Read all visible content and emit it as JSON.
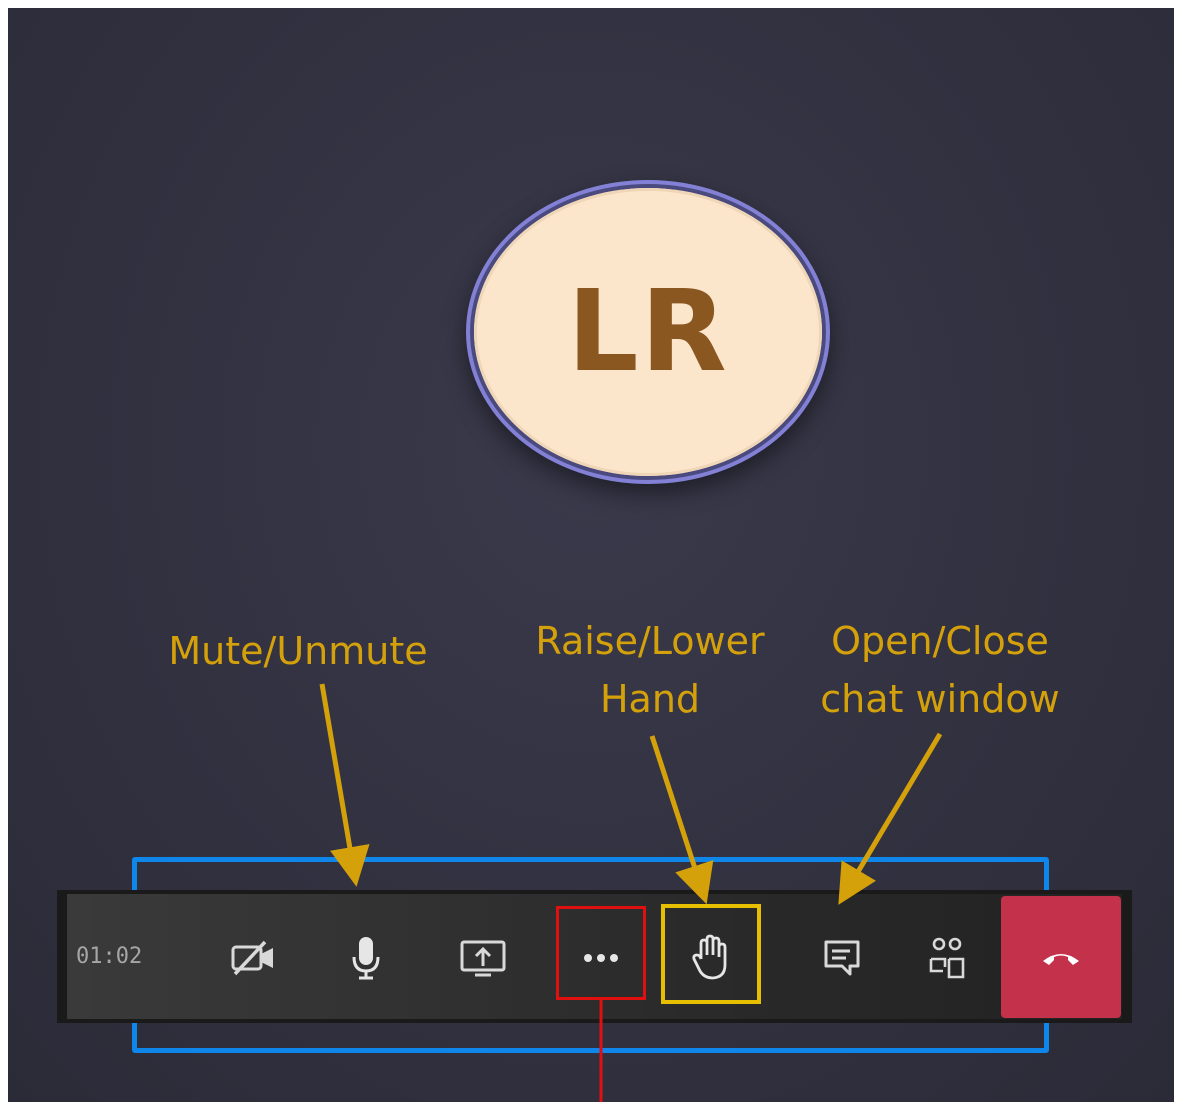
{
  "meeting": {
    "avatar_initials": "LR",
    "timer": "01:02"
  },
  "annotations": {
    "mute": "Mute/Unmute",
    "raise_line1": "Raise/Lower",
    "raise_line2": "Hand",
    "chat_line1": "Open/Close",
    "chat_line2": "chat window"
  },
  "toolbar": {
    "buttons": [
      {
        "name": "camera-off",
        "icon": "video-off-icon"
      },
      {
        "name": "microphone",
        "icon": "mic-icon"
      },
      {
        "name": "share-screen",
        "icon": "share-screen-icon"
      },
      {
        "name": "more-actions",
        "icon": "more-icon"
      },
      {
        "name": "raise-hand",
        "icon": "hand-icon"
      },
      {
        "name": "chat",
        "icon": "chat-icon"
      },
      {
        "name": "participants",
        "icon": "people-icon"
      },
      {
        "name": "hang-up",
        "icon": "phone-hangup-icon"
      }
    ]
  },
  "colors": {
    "annotation_text": "#d4a10b",
    "annotation_arrow": "#d4a10b",
    "highlight_red": "#e11010",
    "highlight_yellow": "#e6c000",
    "frame_blue": "#0e86ea",
    "hangup_red": "#c4314b",
    "avatar_fill": "#fbe6cc",
    "avatar_ring": "#8381d6",
    "initials_color": "#8a5721"
  }
}
